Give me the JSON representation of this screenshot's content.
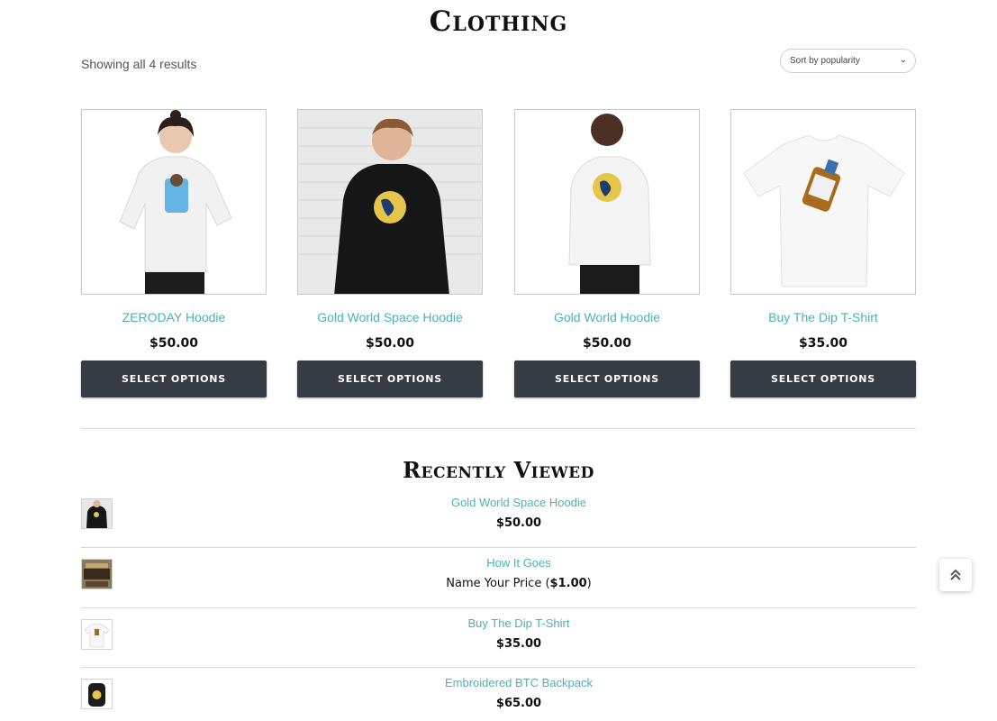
{
  "page": {
    "title": "Clothing"
  },
  "toolbar": {
    "result_count": "Showing all 4 results",
    "sort_value": "Sort by popularity"
  },
  "products": [
    {
      "name": "ZERODAY Hoodie",
      "price": "$50.00",
      "button": "SELECT OPTIONS"
    },
    {
      "name": "Gold World Space Hoodie",
      "price": "$50.00",
      "button": "SELECT OPTIONS"
    },
    {
      "name": "Gold World Hoodie",
      "price": "$50.00",
      "button": "SELECT OPTIONS"
    },
    {
      "name": "Buy The Dip T-Shirt",
      "price": "$35.00",
      "button": "SELECT OPTIONS"
    }
  ],
  "recently_viewed": {
    "title": "Recently Viewed",
    "items": [
      {
        "name": "Gold World Space Hoodie",
        "price": "$50.00"
      },
      {
        "name": "How It Goes",
        "price_prefix": "Name Your Price (",
        "price": "$1.00",
        "price_suffix": ")"
      },
      {
        "name": "Buy The Dip T-Shirt",
        "price": "$35.00"
      },
      {
        "name": "Embroidered BTC Backpack",
        "price": "$65.00"
      }
    ]
  },
  "icons": {
    "sort_chevron": "chevron-down-icon",
    "scroll_top": "double-chevron-up-icon"
  },
  "colors": {
    "link": "#4bb3b3",
    "button_bg": "#363c43"
  }
}
